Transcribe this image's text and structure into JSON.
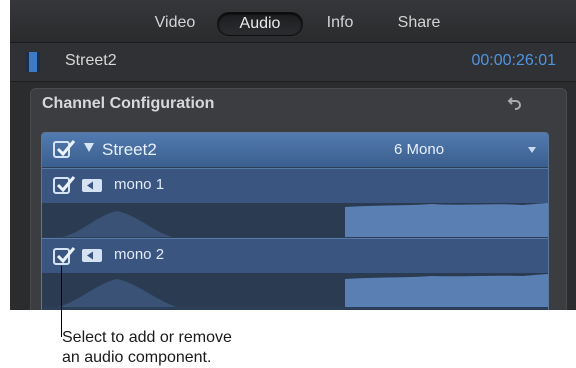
{
  "tabs": [
    {
      "label": "Video",
      "active": false
    },
    {
      "label": "Audio",
      "active": true
    },
    {
      "label": "Info",
      "active": false
    },
    {
      "label": "Share",
      "active": false
    }
  ],
  "clip": {
    "icon": "film-icon",
    "name": "Street2",
    "timecode": "00:00:26:01"
  },
  "panel": {
    "title": "Channel Configuration",
    "reset_icon": "reset-arrow-icon",
    "group": {
      "name": "Street2",
      "config": "6 Mono",
      "checked": true
    },
    "components": [
      {
        "name": "mono 1",
        "checked": true
      },
      {
        "name": "mono 2",
        "checked": true
      }
    ]
  },
  "callout": {
    "line1": "Select to add or remove",
    "line2": "an audio component."
  },
  "colors": {
    "accent": "#4e95e0",
    "header_blue": "#537bb0",
    "component_bg": "#3a5680",
    "wave": "#5a7fb2"
  }
}
